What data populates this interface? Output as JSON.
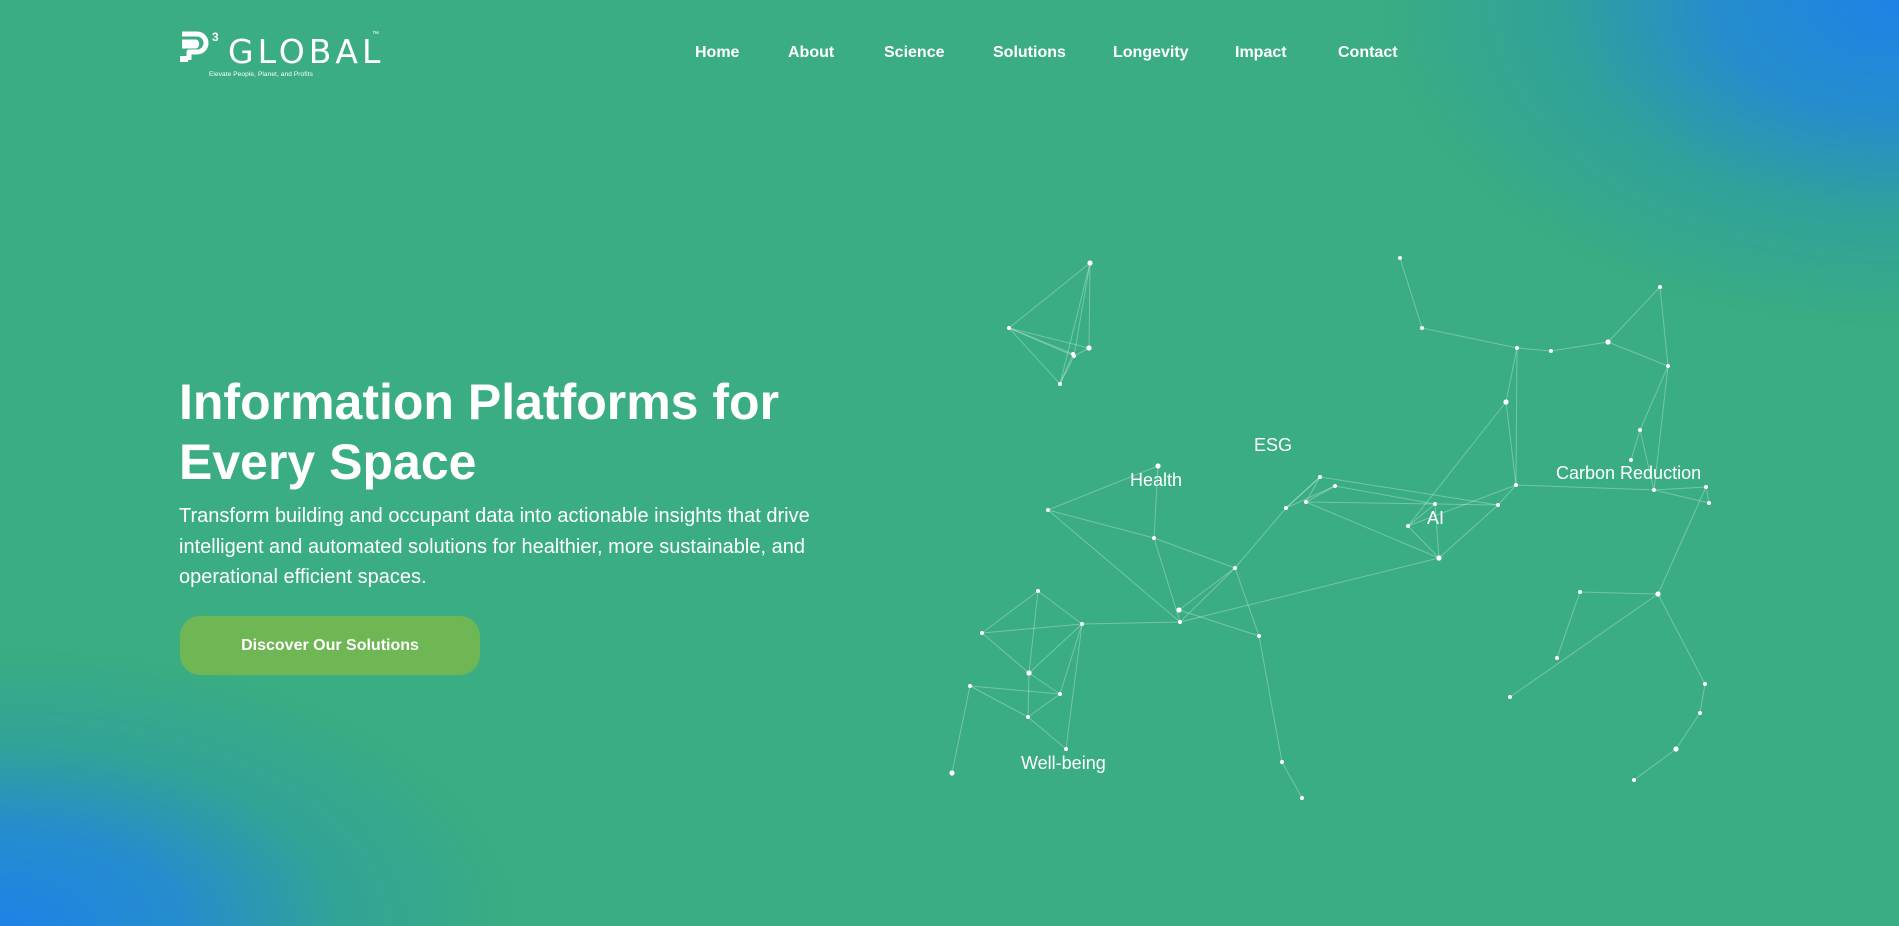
{
  "header": {
    "logo": {
      "wordmark": "GLOBAL",
      "superscript": "3",
      "trademark": "™",
      "tagline": "Elevate People, Planet, and Profits"
    },
    "nav": [
      {
        "label": "Home"
      },
      {
        "label": "About"
      },
      {
        "label": "Science"
      },
      {
        "label": "Solutions"
      },
      {
        "label": "Longevity"
      },
      {
        "label": "Impact"
      },
      {
        "label": "Contact"
      }
    ]
  },
  "hero": {
    "title": "Information Platforms for Every Space",
    "subtitle": "Transform building and occupant data into actionable insights that drive intelligent and automated solutions for healthier, more sustainable, and operational efficient spaces.",
    "cta_label": "Discover Our Solutions"
  },
  "network": {
    "labels": [
      "Health",
      "ESG",
      "AI",
      "Carbon Reduction",
      "Well-being"
    ]
  },
  "colors": {
    "background": "#3aad82",
    "corner_gradient": "#1e82e6",
    "cta": "#6fb655",
    "text": "#ffffff"
  }
}
